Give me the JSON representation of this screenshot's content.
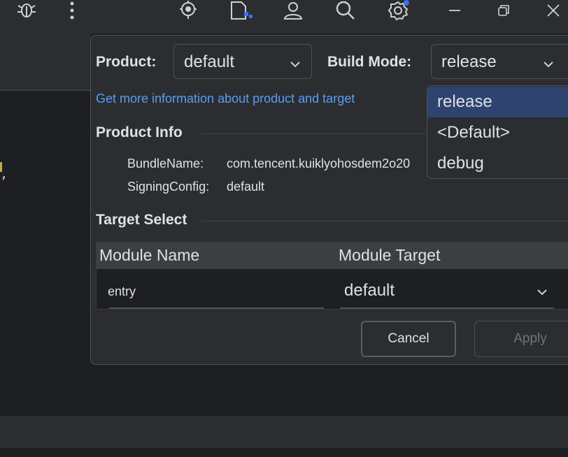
{
  "toolbar": {
    "icons": [
      "debug-bug-icon",
      "more-vertical-icon",
      "location-target-icon",
      "device-file-icon",
      "account-icon",
      "search-icon",
      "settings-icon",
      "minimize-icon",
      "restore-icon",
      "close-icon"
    ],
    "settings_badge_color": "#3574f0"
  },
  "editor": {
    "code_fragment": ","
  },
  "dialog": {
    "product_label": "Product:",
    "product_value": "default",
    "build_mode_label": "Build Mode:",
    "build_mode_value": "release",
    "info_link": "Get more information about product and target",
    "product_info": {
      "title": "Product Info",
      "bundle_name_label": "BundleName:",
      "bundle_name_value": "com.tencent.kuiklyohosdem2o20",
      "signing_config_label": "SigningConfig:",
      "signing_config_value": "default"
    },
    "target_select": {
      "title": "Target Select",
      "columns": [
        "Module Name",
        "Module Target"
      ],
      "rows": [
        {
          "module_name": "entry",
          "module_target": "default"
        }
      ]
    },
    "buttons": {
      "cancel": "Cancel",
      "apply": "Apply"
    }
  },
  "build_mode_dropdown": {
    "options": [
      "release",
      "<Default>",
      "debug"
    ],
    "selected": "release"
  },
  "colors": {
    "background": "#1e1f22",
    "panel": "#2b2d30",
    "link": "#589df6",
    "selection": "#2e436e"
  }
}
